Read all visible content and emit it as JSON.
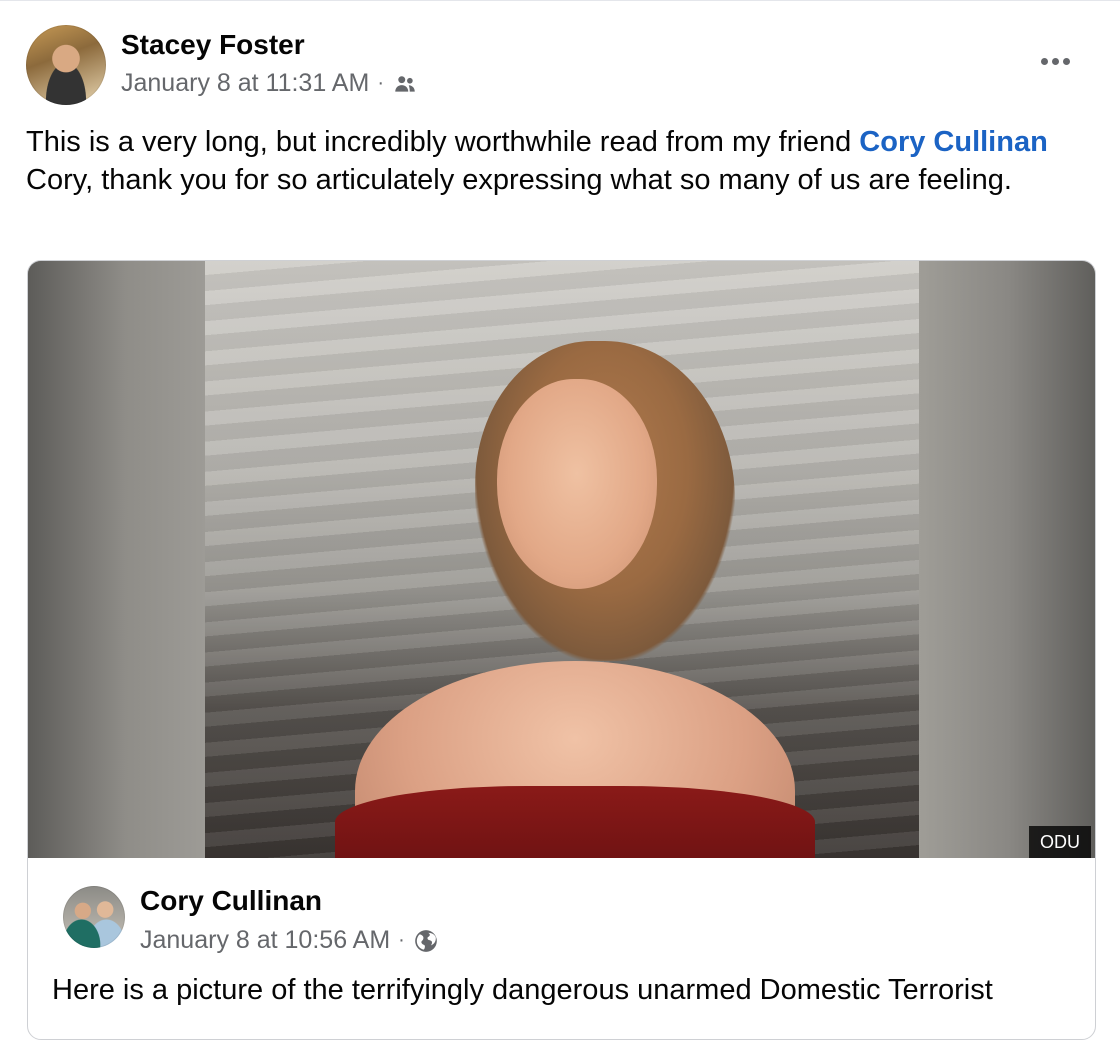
{
  "post": {
    "author": "Stacey Foster",
    "timestamp": "January 8 at 11:31 AM",
    "separator": "·",
    "audience_icon": "friends-icon",
    "more_icon": "more-horizontal-icon",
    "text_before": "This is a very long, but incredibly worthwhile read from my friend ",
    "mention": "Cory Cullinan",
    "text_after": " Cory, thank you for so articulately expressing what so many of us are feeling."
  },
  "shared_post": {
    "photo_credit": "ODU",
    "author": "Cory Cullinan",
    "timestamp": "January 8 at 10:56 AM",
    "separator": "·",
    "audience_icon": "globe-icon",
    "text": "Here is a picture of the terrifyingly dangerous unarmed Domestic Terrorist"
  },
  "colors": {
    "link": "#1b63c4",
    "secondary_text": "#65676b",
    "primary_text": "#050505"
  }
}
